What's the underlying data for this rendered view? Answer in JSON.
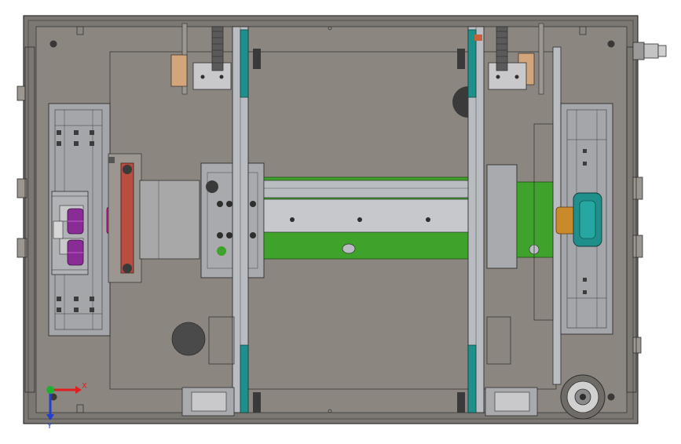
{
  "viewport": {
    "background": "#ffffff",
    "line_color": "#2e2e2e",
    "frame_color": "#7b7772",
    "plate_color": "#8b8680",
    "rail_color": "#b9bcc0",
    "green_color": "#3fa32b",
    "pink_color": "#e0149a",
    "purple_color": "#8a2c96",
    "red_belt_color": "#b84d40",
    "teal_color": "#1f8f8b",
    "brass_color": "#c88a2b",
    "copper_color": "#c8623a"
  },
  "triad": {
    "x_label": "X",
    "y_label": "Y",
    "x_color": "#e02020",
    "y_color": "#2040d0",
    "z_color": "#20b030"
  },
  "icons": {
    "triad": "axis-triad-icon",
    "hole": "bolt-hole-icon"
  }
}
